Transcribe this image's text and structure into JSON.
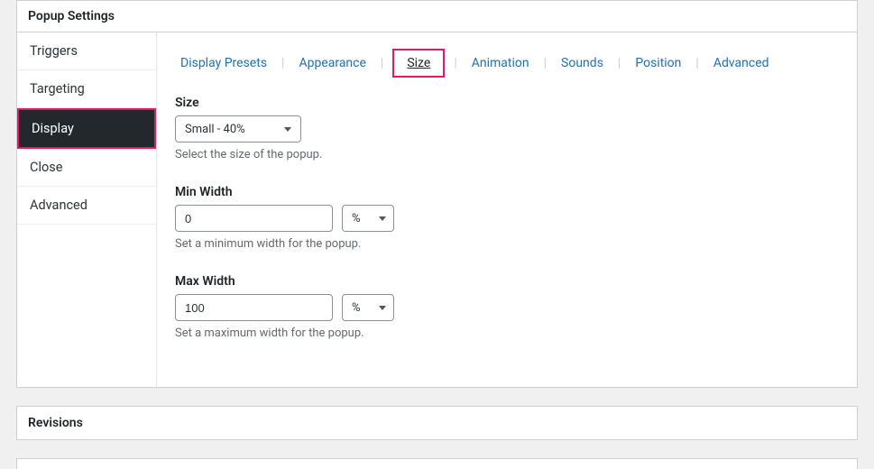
{
  "panel_title": "Popup Settings",
  "side_tabs": {
    "triggers": "Triggers",
    "targeting": "Targeting",
    "display": "Display",
    "close": "Close",
    "advanced": "Advanced"
  },
  "sub_tabs": {
    "display_presets": "Display Presets",
    "appearance": "Appearance",
    "size": "Size",
    "animation": "Animation",
    "sounds": "Sounds",
    "position": "Position",
    "advanced": "Advanced"
  },
  "size": {
    "label": "Size",
    "value": "Small - 40%",
    "help": "Select the size of the popup."
  },
  "min_width": {
    "label": "Min Width",
    "value": "0",
    "unit": "%",
    "help": "Set a minimum width for the popup."
  },
  "max_width": {
    "label": "Max Width",
    "value": "100",
    "unit": "%",
    "help": "Set a maximum width for the popup."
  },
  "revisions_title": "Revisions"
}
